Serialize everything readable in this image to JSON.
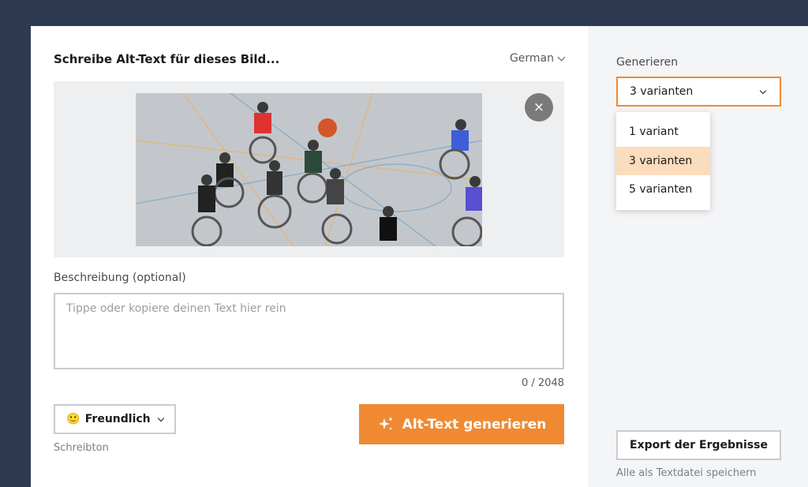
{
  "form": {
    "heading": "Schreibe Alt-Text für dieses Bild...",
    "language": "German",
    "close_symbol": "×",
    "image_icon": "uploaded-photo",
    "description_label": "Beschreibung (optional)",
    "description_value": "",
    "description_placeholder": "Tippe oder kopiere deinen Text hier rein",
    "char_counter": "0 / 2048",
    "tone_emoji": "🙂",
    "tone_value": "Freundlich",
    "tone_hint": "Schreibton",
    "generate_icon": "sparkles-icon",
    "generate_label": "Alt-Text generieren"
  },
  "sidebar": {
    "generate_label": "Generieren",
    "selected_variants": "3 varianten",
    "variant_options": [
      {
        "label": "1 variant",
        "selected": false
      },
      {
        "label": "3 varianten",
        "selected": true
      },
      {
        "label": "5 varianten",
        "selected": false
      }
    ],
    "export_label": "Export der Ergebnisse",
    "export_hint": "Alle als Textdatei speichern"
  },
  "colors": {
    "accent": "#f08a32",
    "option_highlight": "#fbdcbc",
    "page_background": "#2d3a52"
  }
}
